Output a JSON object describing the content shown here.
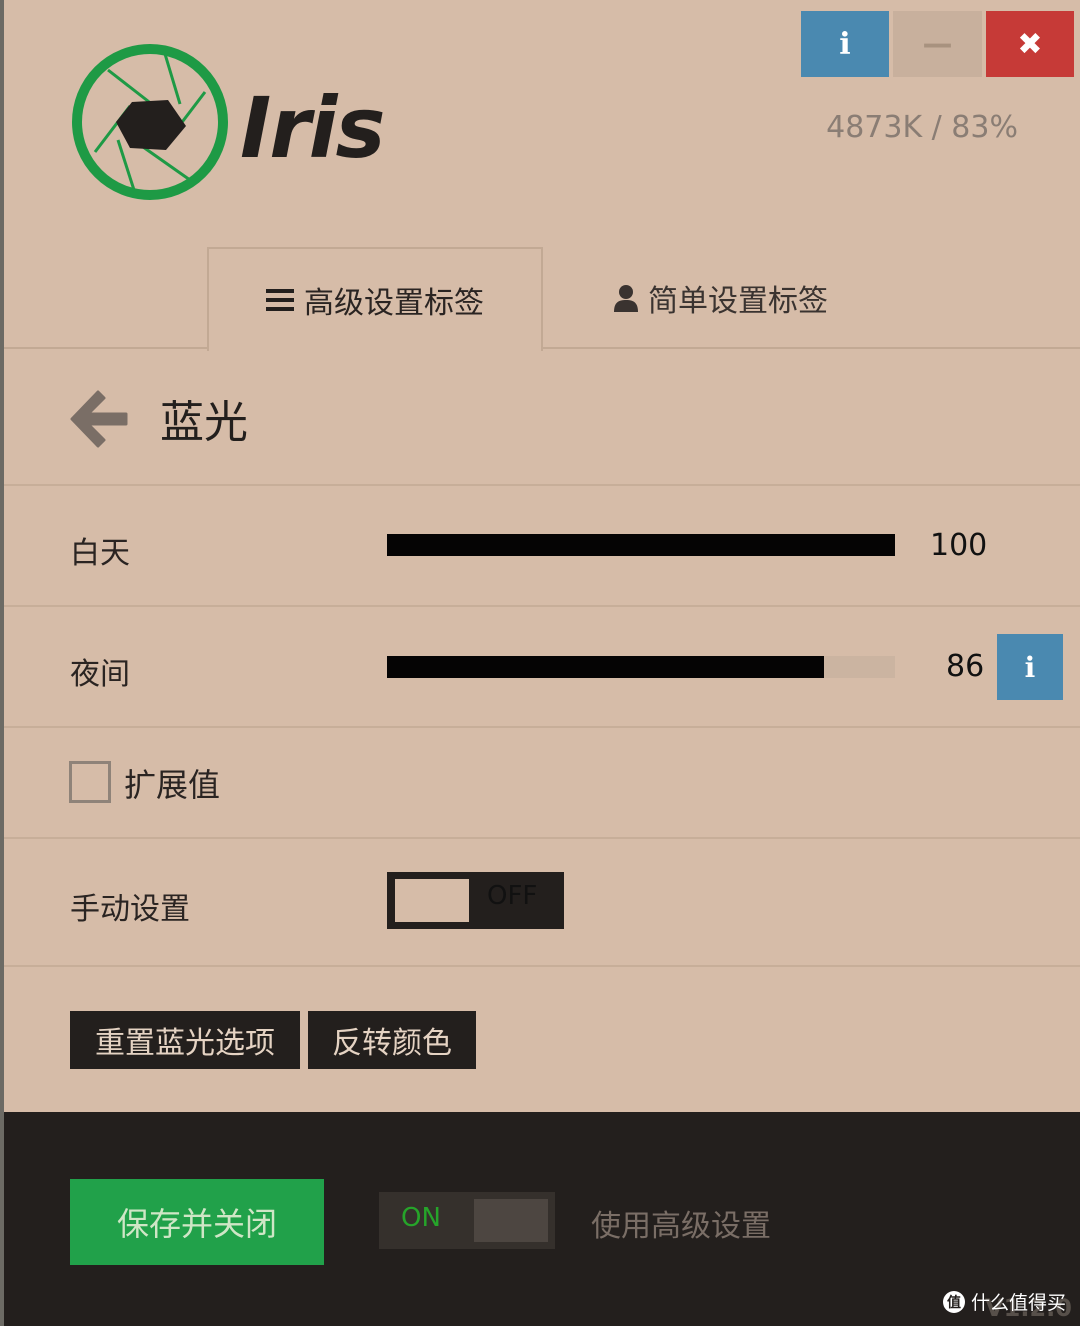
{
  "app": {
    "logo_text": "Iris",
    "stats": "4873K / 83%",
    "window_buttons": {
      "info": "i",
      "minimize": "—",
      "close": "✖"
    }
  },
  "tabs": [
    {
      "label": "高级设置标签",
      "icon": "hamburger-icon",
      "active": true
    },
    {
      "label": "简单设置标签",
      "icon": "user-icon",
      "active": false
    }
  ],
  "section": {
    "title": "蓝光"
  },
  "sliders": [
    {
      "label": "白天",
      "value": "100",
      "fraction": 1.0
    },
    {
      "label": "夜间",
      "value": "86",
      "fraction": 0.86
    }
  ],
  "row_info_label": "i",
  "checkbox": {
    "label": "扩展值",
    "checked": false
  },
  "manual": {
    "label": "手动设置",
    "toggle_text": "OFF"
  },
  "buttons": {
    "reset": "重置蓝光选项",
    "invert": "反转颜色"
  },
  "footer": {
    "save_button": "保存并关闭",
    "toggle_text": "ON",
    "label": "使用高级设置",
    "watermark": "什么值得买",
    "version": "V1.2.0"
  },
  "colors": {
    "background": "#d6bca8",
    "accent_blue": "#4a89b0",
    "close_red": "#c63a37",
    "logo_green": "#1e9a45",
    "save_green": "#21a14a",
    "dark": "#231f1d"
  }
}
